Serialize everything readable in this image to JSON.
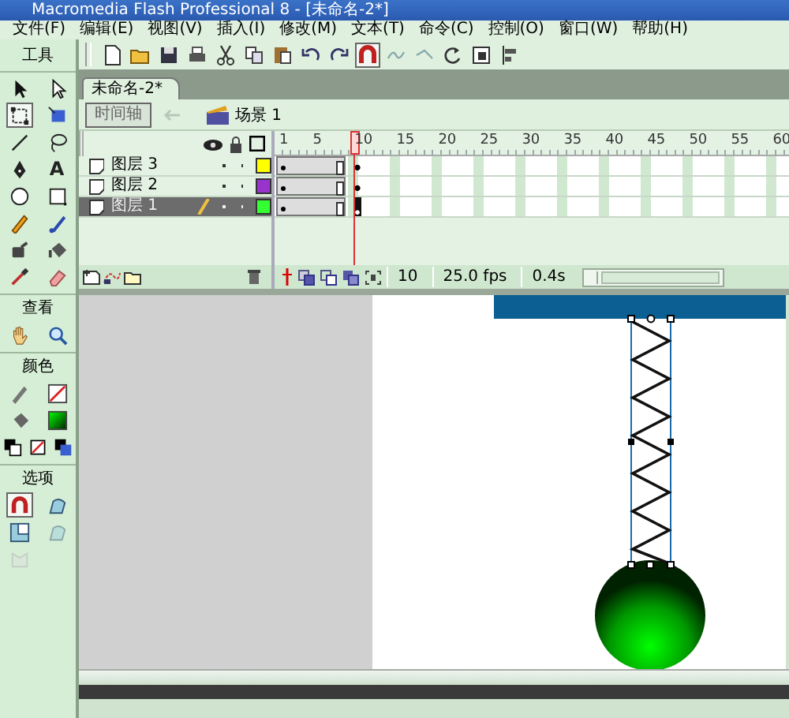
{
  "window": {
    "title": "Macromedia Flash Professional 8 - [未命名-2*]"
  },
  "menu": [
    "文件(F)",
    "编辑(E)",
    "视图(V)",
    "插入(I)",
    "修改(M)",
    "文本(T)",
    "命令(C)",
    "控制(O)",
    "窗口(W)",
    "帮助(H)"
  ],
  "toolbar": [
    {
      "kind": "new",
      "selected": false
    },
    {
      "kind": "open",
      "selected": false
    },
    {
      "kind": "save",
      "selected": false
    },
    {
      "kind": "print",
      "selected": false
    },
    {
      "kind": "cut",
      "selected": false
    },
    {
      "kind": "copy",
      "selected": false
    },
    {
      "kind": "paste",
      "selected": false
    },
    {
      "kind": "undo",
      "selected": false
    },
    {
      "kind": "redo",
      "selected": false
    },
    {
      "kind": "snap",
      "selected": true
    },
    {
      "kind": "smooth",
      "selected": false
    },
    {
      "kind": "straighten",
      "selected": false
    },
    {
      "kind": "rotate",
      "selected": false
    },
    {
      "kind": "scale",
      "selected": false
    },
    {
      "kind": "align",
      "selected": false
    }
  ],
  "tools_panel": [
    {
      "label": "工具",
      "tools": [
        {
          "kind": "arrow",
          "selected": false
        },
        {
          "kind": "subselect",
          "selected": false
        },
        {
          "kind": "transform",
          "selected": true
        },
        {
          "kind": "fill-transform",
          "selected": false
        },
        {
          "kind": "line",
          "selected": false
        },
        {
          "kind": "lasso",
          "selected": false
        },
        {
          "kind": "pen",
          "selected": false
        },
        {
          "kind": "text",
          "glyph": "A",
          "selected": false
        },
        {
          "kind": "oval",
          "selected": false
        },
        {
          "kind": "rect",
          "selected": false
        },
        {
          "kind": "pencil",
          "selected": false
        },
        {
          "kind": "brush",
          "selected": false
        },
        {
          "kind": "ink",
          "selected": false
        },
        {
          "kind": "bucket",
          "selected": false
        },
        {
          "kind": "dropper",
          "selected": false
        },
        {
          "kind": "eraser",
          "selected": false
        }
      ]
    },
    {
      "label": "查看",
      "tools": [
        {
          "kind": "hand",
          "selected": false
        },
        {
          "kind": "zoom",
          "selected": false
        }
      ]
    },
    {
      "label": "颜色",
      "tools": [
        {
          "kind": "stroke-pencil",
          "selected": false
        },
        {
          "kind": "stroke-swatch",
          "selected": false
        },
        {
          "kind": "fill-bucket",
          "selected": false
        },
        {
          "kind": "fill-swatch",
          "selected": false
        },
        {
          "kind": "black-white",
          "selected": false
        },
        {
          "kind": "no-color",
          "selected": false
        },
        {
          "kind": "swap",
          "selected": false
        }
      ]
    },
    {
      "label": "选项",
      "tools": [
        {
          "kind": "magnet",
          "selected": true
        },
        {
          "kind": "smooth-option",
          "selected": false
        },
        {
          "kind": "scale-option",
          "selected": false
        },
        {
          "kind": "smooth-option",
          "selected": false,
          "disabled": true
        },
        {
          "kind": "straighten-option",
          "selected": false,
          "disabled": true
        }
      ]
    }
  ],
  "document_tab": {
    "label": "未命名-2*",
    "selected": true
  },
  "timeline": {
    "button": "时间轴",
    "scene": "场景 1",
    "ruler": [
      "1",
      "5",
      "10",
      "15",
      "20",
      "25",
      "30",
      "35",
      "40",
      "45",
      "50",
      "55",
      "60"
    ],
    "layers": [
      {
        "name": "图层 3",
        "selected": false,
        "color": "#ffff00"
      },
      {
        "name": "图层 2",
        "selected": false,
        "color": "#9933cc"
      },
      {
        "name": "图层 1",
        "selected": true,
        "color": "#33ff33"
      }
    ],
    "current_frame": "10",
    "frame_rate": "25.0 fps",
    "elapsed": "0.4s"
  }
}
